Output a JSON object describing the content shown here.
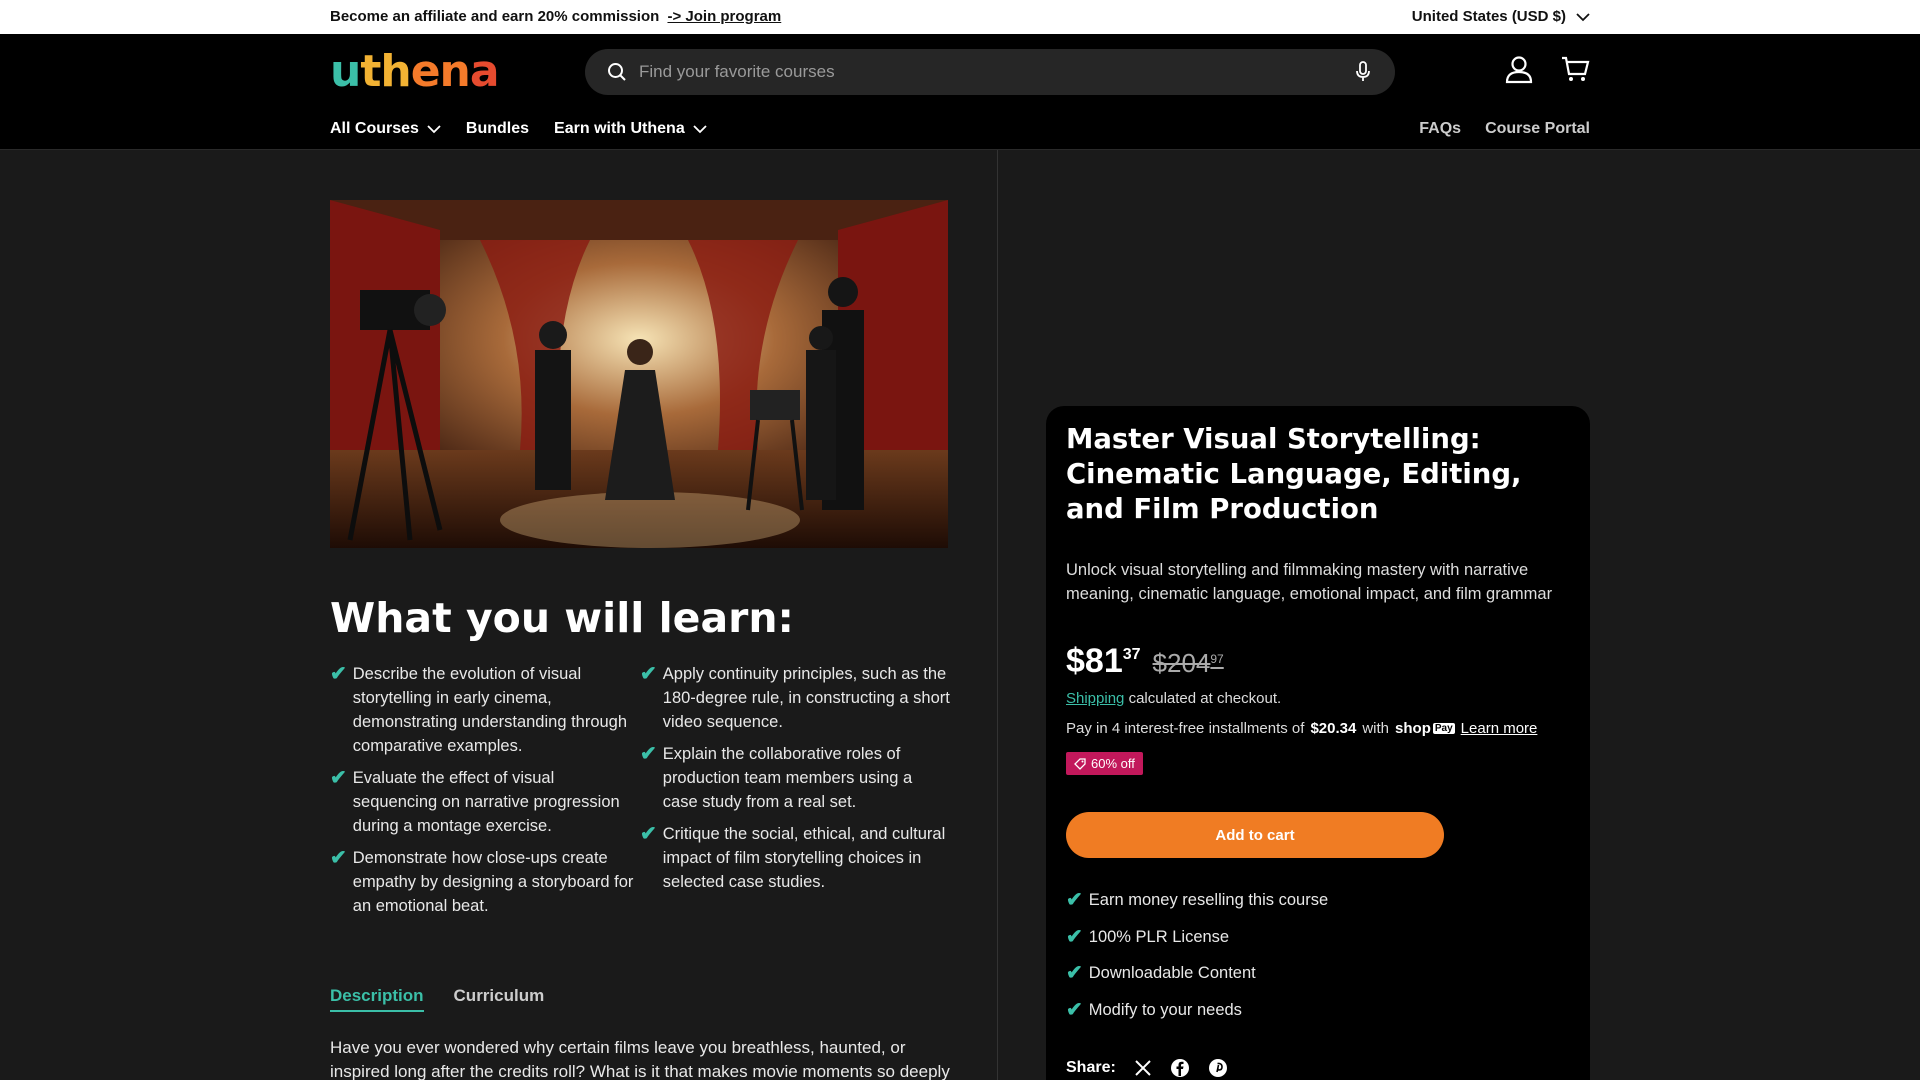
{
  "announcement": {
    "text": "Become an affiliate and earn 20% commission",
    "link": "-> Join program",
    "region": "United States (USD $)"
  },
  "header": {
    "logo": [
      "u",
      "th",
      "en",
      "a"
    ],
    "search_placeholder": "Find your favorite courses",
    "nav": [
      "All Courses",
      "Bundles",
      "Earn with Uthena"
    ],
    "nav_right": [
      "FAQs",
      "Course Portal"
    ]
  },
  "learn": {
    "title": "What you will learn:",
    "col1": [
      "Describe the evolution of visual storytelling in early cinema, demonstrating understanding through comparative examples.",
      "Evaluate the effect of visual sequencing on narrative progression during a montage exercise.",
      "Demonstrate how close-ups create empathy by designing a storyboard for an emotional beat."
    ],
    "col2": [
      "Apply continuity principles, such as the 180-degree rule, in constructing a short video sequence.",
      "Explain the collaborative roles of production team members using a case study from a real set.",
      "Critique the social, ethical, and cultural impact of film storytelling choices in selected case studies."
    ]
  },
  "tabs": [
    "Description",
    "Curriculum"
  ],
  "description": "Have you ever wondered why certain films leave you breathless, haunted, or inspired long after the credits roll? What is it that makes movie moments so deeply",
  "product": {
    "title": "Master Visual Storytelling: Cinematic Language, Editing, and Film Production",
    "subtitle": "Unlock visual storytelling and filmmaking mastery with narrative meaning, cinematic language, emotional impact, and film grammar",
    "price_main": "$81",
    "price_cents": "37",
    "was_main": "$204",
    "was_cents": "97",
    "shipping_link": "Shipping",
    "shipping_text": "calculated at checkout.",
    "install_text": "Pay in 4 interest-free installments of",
    "install_amount": "$20.34",
    "install_with": "with",
    "shop_text": "shop",
    "pay_text": "Pay",
    "learn_more": "Learn more",
    "badge": "60% off",
    "add_to_cart": "Add to cart",
    "features": [
      "Earn money reselling this course",
      "100% PLR License",
      "Downloadable Content",
      "Modify to your needs"
    ],
    "share_label": "Share:"
  },
  "colors": {
    "accent": "#3bbfa8",
    "cta": "#f07c23",
    "badge": "#c2185b"
  }
}
